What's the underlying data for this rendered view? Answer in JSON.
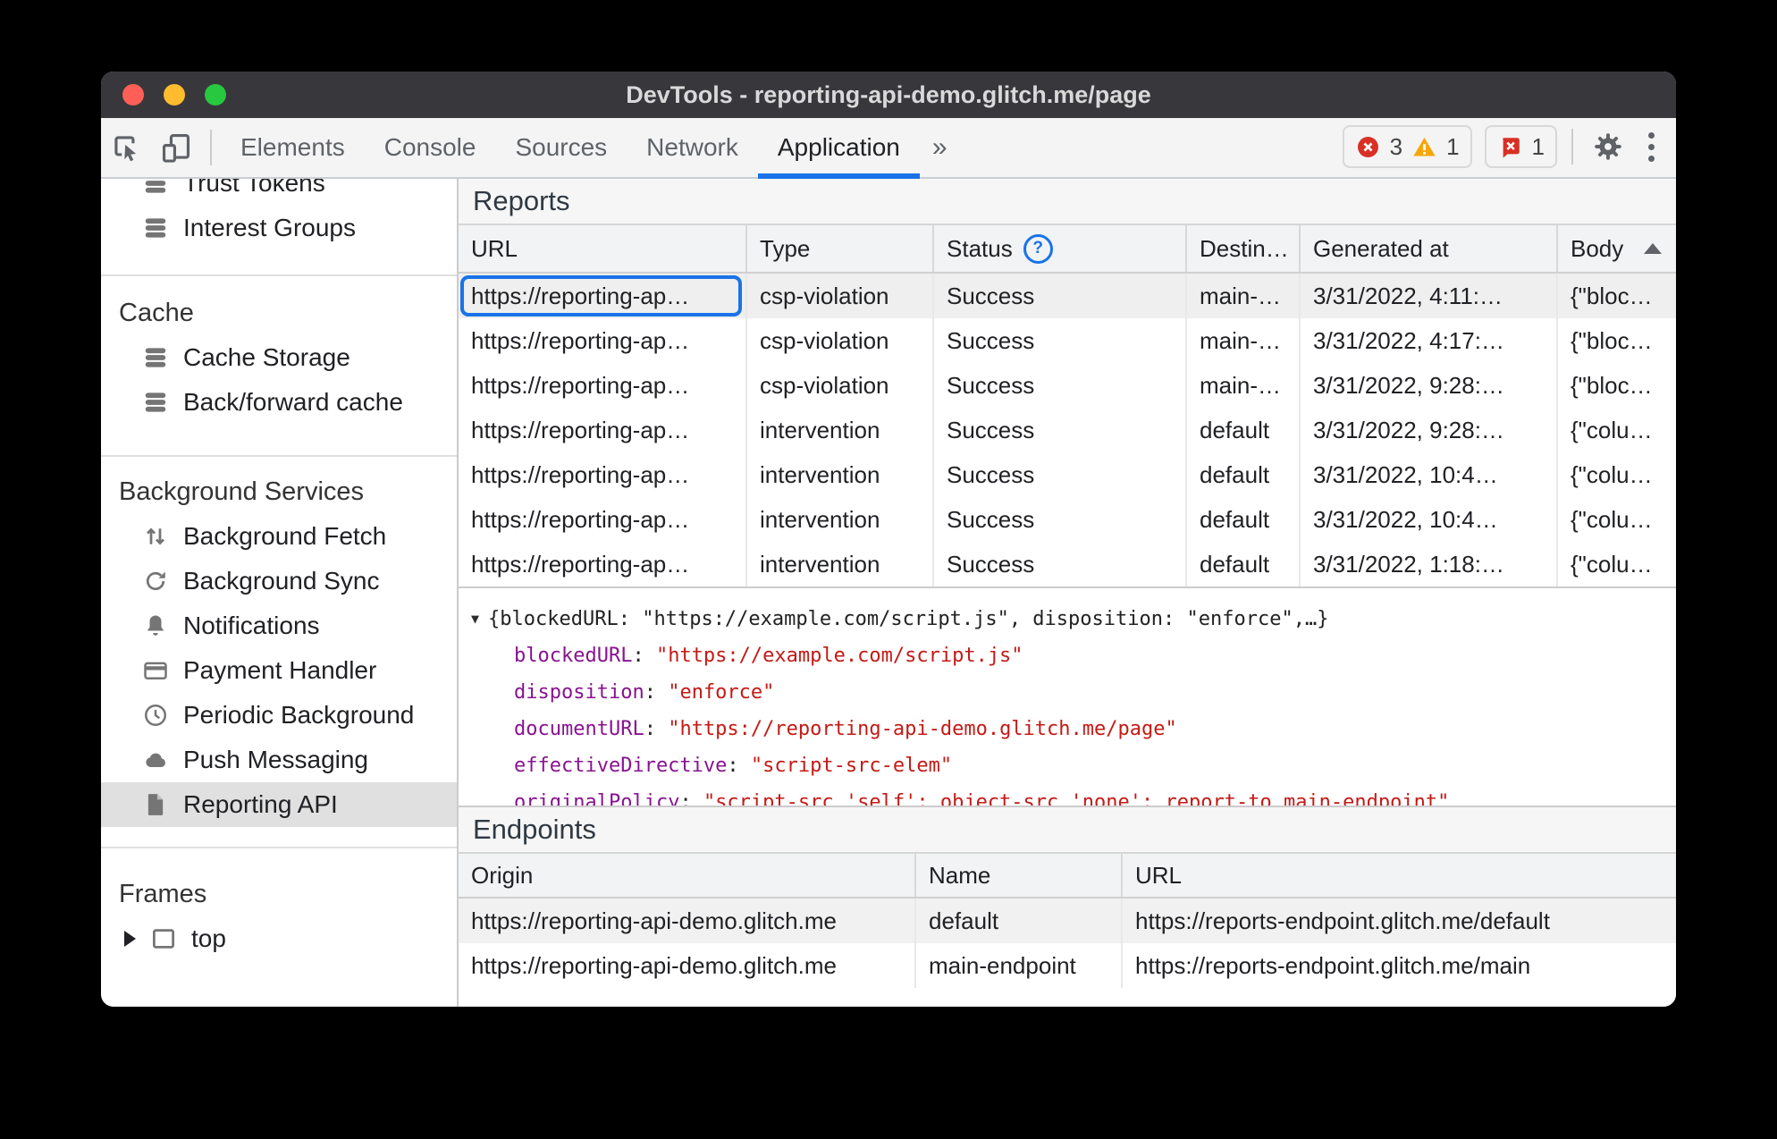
{
  "window_title": "DevTools - reporting-api-demo.glitch.me/page",
  "toolbar": {
    "tabs": [
      "Elements",
      "Console",
      "Sources",
      "Network",
      "Application"
    ],
    "active_tab": "Application",
    "overflow_symbol": "»",
    "error_count": "3",
    "warning_count": "1",
    "issues_count": "1"
  },
  "sidebar": {
    "top_items": [
      {
        "label": "Trust Tokens",
        "icon": "database-icon"
      },
      {
        "label": "Interest Groups",
        "icon": "database-icon"
      }
    ],
    "cache_section": {
      "title": "Cache",
      "items": [
        {
          "label": "Cache Storage",
          "icon": "database-icon"
        },
        {
          "label": "Back/forward cache",
          "icon": "database-icon"
        }
      ]
    },
    "bg_section": {
      "title": "Background Services",
      "items": [
        {
          "label": "Background Fetch",
          "icon": "up-down-arrows-icon"
        },
        {
          "label": "Background Sync",
          "icon": "sync-icon"
        },
        {
          "label": "Notifications",
          "icon": "bell-icon"
        },
        {
          "label": "Payment Handler",
          "icon": "credit-card-icon"
        },
        {
          "label": "Periodic Background",
          "icon": "clock-icon"
        },
        {
          "label": "Push Messaging",
          "icon": "cloud-icon"
        },
        {
          "label": "Reporting API",
          "icon": "document-icon",
          "selected": true
        }
      ]
    },
    "frames_section": {
      "title": "Frames",
      "items": [
        {
          "label": "top",
          "icon": "frame-icon"
        }
      ]
    }
  },
  "reports": {
    "title": "Reports",
    "columns": {
      "url": "URL",
      "type": "Type",
      "status": "Status",
      "destination": "Destin…",
      "generated": "Generated at",
      "body": "Body"
    },
    "rows": [
      {
        "url": "https://reporting-ap…",
        "type": "csp-violation",
        "status": "Success",
        "destination": "main-…",
        "generated": "3/31/2022, 4:11:…",
        "body": "{\"bloc…"
      },
      {
        "url": "https://reporting-ap…",
        "type": "csp-violation",
        "status": "Success",
        "destination": "main-…",
        "generated": "3/31/2022, 4:17:…",
        "body": "{\"bloc…"
      },
      {
        "url": "https://reporting-ap…",
        "type": "csp-violation",
        "status": "Success",
        "destination": "main-…",
        "generated": "3/31/2022, 9:28:…",
        "body": "{\"bloc…"
      },
      {
        "url": "https://reporting-ap…",
        "type": "intervention",
        "status": "Success",
        "destination": "default",
        "generated": "3/31/2022, 9:28:…",
        "body": "{\"colu…"
      },
      {
        "url": "https://reporting-ap…",
        "type": "intervention",
        "status": "Success",
        "destination": "default",
        "generated": "3/31/2022, 10:4…",
        "body": "{\"colu…"
      },
      {
        "url": "https://reporting-ap…",
        "type": "intervention",
        "status": "Success",
        "destination": "default",
        "generated": "3/31/2022, 10:4…",
        "body": "{\"colu…"
      },
      {
        "url": "https://reporting-ap…",
        "type": "intervention",
        "status": "Success",
        "destination": "default",
        "generated": "3/31/2022, 1:18:…",
        "body": "{\"colu…"
      }
    ]
  },
  "report_detail": {
    "preview": "{blockedURL: \"https://example.com/script.js\", disposition: \"enforce\",…}",
    "properties": [
      {
        "key": "blockedURL",
        "value": "\"https://example.com/script.js\""
      },
      {
        "key": "disposition",
        "value": "\"enforce\""
      },
      {
        "key": "documentURL",
        "value": "\"https://reporting-api-demo.glitch.me/page\""
      },
      {
        "key": "effectiveDirective",
        "value": "\"script-src-elem\""
      },
      {
        "key": "originalPolicy",
        "value": "\"script-src 'self'; object-src 'none'; report-to main-endpoint\""
      }
    ]
  },
  "endpoints": {
    "title": "Endpoints",
    "columns": {
      "origin": "Origin",
      "name": "Name",
      "url": "URL"
    },
    "rows": [
      {
        "origin": "https://reporting-api-demo.glitch.me",
        "name": "default",
        "url": "https://reports-endpoint.glitch.me/default"
      },
      {
        "origin": "https://reporting-api-demo.glitch.me",
        "name": "main-endpoint",
        "url": "https://reports-endpoint.glitch.me/main"
      }
    ]
  },
  "colors": {
    "accent": "#1a73e8",
    "error": "#d93025",
    "warning": "#f6a609",
    "json_key": "#881391",
    "json_string": "#c41a16"
  }
}
